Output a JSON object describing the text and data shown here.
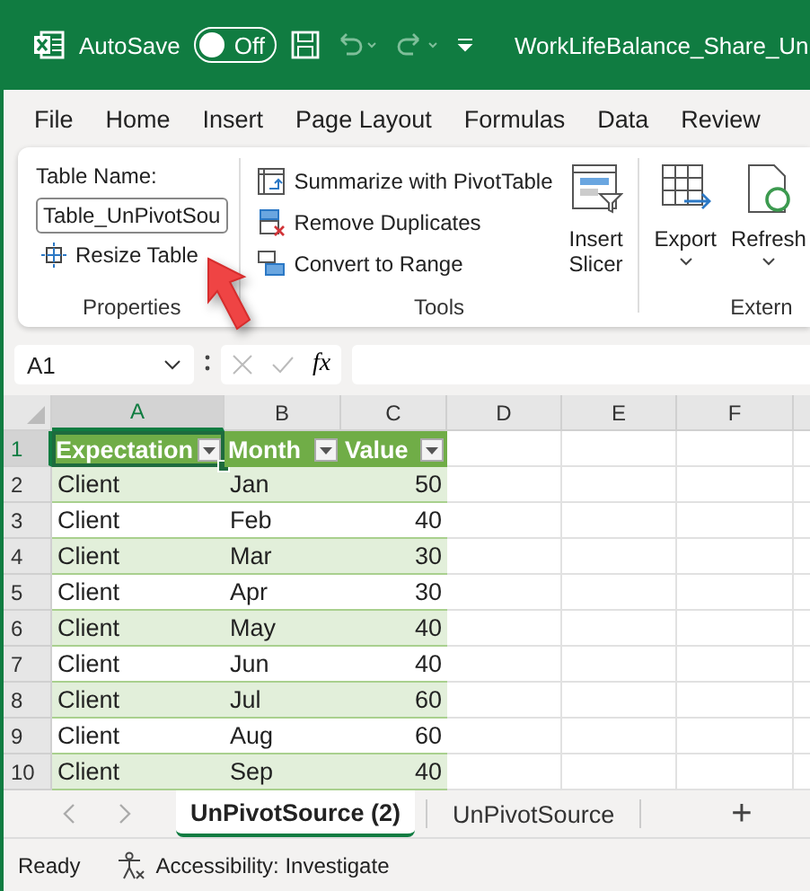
{
  "title_bar": {
    "autosave_label": "AutoSave",
    "autosave": {
      "on": false,
      "label": "Off"
    },
    "filename": "WorkLifeBalance_Share_Un"
  },
  "ribbon_tabs": [
    "File",
    "Home",
    "Insert",
    "Page Layout",
    "Formulas",
    "Data",
    "Review"
  ],
  "properties_group": {
    "table_name_label": "Table Name:",
    "table_name_value": "Table_UnPivotSou",
    "resize_button": "Resize Table",
    "label": "Properties"
  },
  "tools_group": {
    "buttons": [
      "Summarize with PivotTable",
      "Remove Duplicates",
      "Convert to Range"
    ],
    "slicer_button": "Insert Slicer",
    "label": "Tools"
  },
  "external_group": {
    "export_button": "Export",
    "refresh_button": "Refresh",
    "label": "Extern"
  },
  "formula_bar": {
    "name_box": "A1",
    "function_label": "fx"
  },
  "sheet": {
    "columns": [
      {
        "label": "A",
        "selected": true
      },
      {
        "label": "B",
        "selected": false
      },
      {
        "label": "C",
        "selected": false
      },
      {
        "label": "D",
        "selected": false
      },
      {
        "label": "E",
        "selected": false
      },
      {
        "label": "F",
        "selected": false
      }
    ],
    "header_row": {
      "number": "1",
      "selected": true,
      "cells": [
        "Expectation",
        "Month",
        "Value"
      ]
    },
    "rows": [
      {
        "number": "2",
        "cells": [
          "Client",
          "Jan",
          "50"
        ]
      },
      {
        "number": "3",
        "cells": [
          "Client",
          "Feb",
          "40"
        ]
      },
      {
        "number": "4",
        "cells": [
          "Client",
          "Mar",
          "30"
        ]
      },
      {
        "number": "5",
        "cells": [
          "Client",
          "Apr",
          "30"
        ]
      },
      {
        "number": "6",
        "cells": [
          "Client",
          "May",
          "40"
        ]
      },
      {
        "number": "7",
        "cells": [
          "Client",
          "Jun",
          "40"
        ]
      },
      {
        "number": "8",
        "cells": [
          "Client",
          "Jul",
          "60"
        ]
      },
      {
        "number": "9",
        "cells": [
          "Client",
          "Aug",
          "60"
        ]
      },
      {
        "number": "10",
        "cells": [
          "Client",
          "Sep",
          "40"
        ]
      }
    ]
  },
  "sheet_tabs": [
    {
      "label": "UnPivotSource (2)",
      "selected": true
    },
    {
      "label": "UnPivotSource",
      "selected": false
    }
  ],
  "add_sheet": "+",
  "status_bar": {
    "ready": "Ready",
    "accessibility": "Accessibility: Investigate"
  }
}
